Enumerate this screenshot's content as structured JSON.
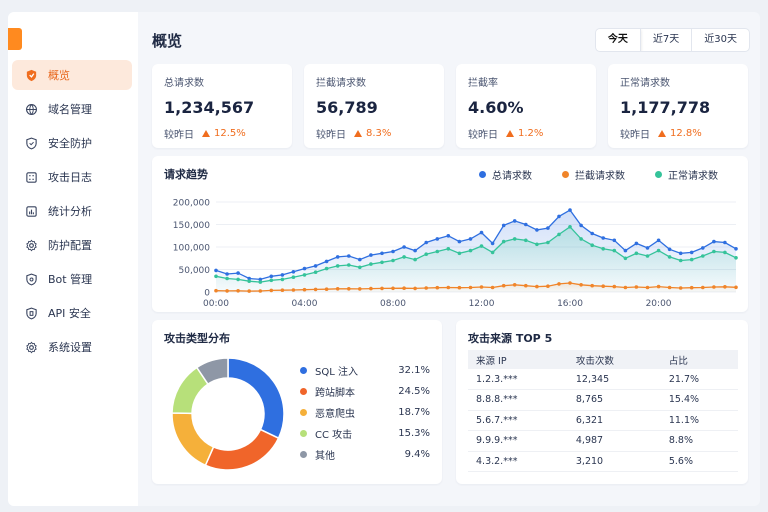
{
  "sidebar": {
    "items": [
      {
        "label": "概览",
        "icon": "shield-brand-icon",
        "active": true
      },
      {
        "label": "域名管理",
        "icon": "globe-icon"
      },
      {
        "label": "安全防护",
        "icon": "shield-icon"
      },
      {
        "label": "攻击日志",
        "icon": "log-icon"
      },
      {
        "label": "统计分析",
        "icon": "chart-icon"
      },
      {
        "label": "防护配置",
        "icon": "gear-icon"
      },
      {
        "label": "Bot 管理",
        "icon": "bot-shield-icon"
      },
      {
        "label": "API 安全",
        "icon": "api-shield-icon"
      },
      {
        "label": "系统设置",
        "icon": "settings-icon"
      }
    ]
  },
  "header": {
    "title": "概览",
    "ranges": [
      "今天",
      "近7天",
      "近30天"
    ],
    "active_range": "今天"
  },
  "stats": [
    {
      "label": "总请求数",
      "value": "1,234,567",
      "compare_label": "较昨日",
      "change": "12.5%"
    },
    {
      "label": "拦截请求数",
      "value": "56,789",
      "compare_label": "较昨日",
      "change": "8.3%"
    },
    {
      "label": "拦截率",
      "value": "4.60%",
      "compare_label": "较昨日",
      "change": "1.2%"
    },
    {
      "label": "正常请求数",
      "value": "1,177,778",
      "compare_label": "较昨日",
      "change": "12.8%"
    }
  ],
  "colors": {
    "accent": "#f06d1e",
    "total": "#2f6fe0",
    "blocked": "#f0852a",
    "normal": "#35c39a"
  },
  "trend": {
    "title": "请求趋势",
    "legend": [
      "总请求数",
      "拦截请求数",
      "正常请求数"
    ]
  },
  "pie": {
    "title": "攻击类型分布"
  },
  "top": {
    "title": "攻击来源 TOP 5",
    "columns": [
      "来源 IP",
      "攻击次数",
      "占比"
    ],
    "rows": [
      [
        "1.2.3.***",
        "12,345",
        "21.7%"
      ],
      [
        "8.8.8.***",
        "8,765",
        "15.4%"
      ],
      [
        "5.6.7.***",
        "6,321",
        "11.1%"
      ],
      [
        "9.9.9.***",
        "4,987",
        "8.8%"
      ],
      [
        "4.3.2.***",
        "3,210",
        "5.6%"
      ]
    ]
  },
  "chart_data": [
    {
      "type": "area",
      "title": "请求趋势",
      "x": [
        "00:00",
        "00:30",
        "01:00",
        "01:30",
        "02:00",
        "02:30",
        "03:00",
        "03:30",
        "04:00",
        "04:30",
        "05:00",
        "05:30",
        "06:00",
        "06:30",
        "07:00",
        "07:30",
        "08:00",
        "08:30",
        "09:00",
        "09:30",
        "10:00",
        "10:30",
        "11:00",
        "11:30",
        "12:00",
        "12:30",
        "13:00",
        "13:30",
        "14:00",
        "14:30",
        "15:00",
        "15:30",
        "16:00",
        "16:30",
        "17:00",
        "17:30",
        "18:00",
        "18:30",
        "19:00",
        "19:30",
        "20:00",
        "20:30",
        "21:00",
        "21:30",
        "22:00",
        "22:30",
        "23:00",
        "23:30"
      ],
      "x_tick_labels": [
        "00:00",
        "04:00",
        "08:00",
        "12:00",
        "16:00",
        "20:00"
      ],
      "y_tick_labels": [
        "0",
        "50,000",
        "100,000",
        "150,000",
        "200,000"
      ],
      "ylim": [
        0,
        200000
      ],
      "grid": true,
      "legend_position": "top-right",
      "series": [
        {
          "name": "总请求数",
          "values": [
            48000,
            40000,
            42000,
            30000,
            28000,
            35000,
            38000,
            45000,
            52000,
            58000,
            68000,
            78000,
            80000,
            72000,
            82000,
            86000,
            90000,
            100000,
            92000,
            110000,
            118000,
            125000,
            112000,
            118000,
            132000,
            108000,
            148000,
            158000,
            150000,
            138000,
            142000,
            168000,
            182000,
            148000,
            130000,
            120000,
            115000,
            92000,
            108000,
            98000,
            115000,
            95000,
            86000,
            88000,
            98000,
            112000,
            110000,
            96000
          ]
        },
        {
          "name": "拦截请求数",
          "values": [
            3000,
            2500,
            2600,
            2000,
            2200,
            3500,
            4000,
            4500,
            5200,
            5800,
            6200,
            7000,
            7200,
            6800,
            7500,
            8000,
            8200,
            8500,
            8000,
            9000,
            9500,
            10000,
            9500,
            10000,
            11000,
            10000,
            14000,
            16000,
            14000,
            12000,
            13000,
            18000,
            20000,
            16000,
            14000,
            13000,
            12000,
            10000,
            11000,
            10000,
            12000,
            10000,
            9000,
            9500,
            10000,
            11000,
            11500,
            10500
          ]
        },
        {
          "name": "正常请求数",
          "values": [
            35000,
            30000,
            28000,
            24000,
            22000,
            26000,
            28000,
            33000,
            38000,
            44000,
            52000,
            58000,
            60000,
            55000,
            62000,
            66000,
            70000,
            78000,
            72000,
            84000,
            90000,
            96000,
            86000,
            92000,
            102000,
            88000,
            112000,
            118000,
            115000,
            106000,
            110000,
            128000,
            145000,
            118000,
            104000,
            96000,
            92000,
            75000,
            86000,
            80000,
            92000,
            78000,
            70000,
            72000,
            80000,
            90000,
            88000,
            76000
          ]
        }
      ]
    },
    {
      "type": "pie",
      "title": "攻击类型分布",
      "categories": [
        "SQL 注入",
        "跨站脚本",
        "恶意爬虫",
        "CC 攻击",
        "其他"
      ],
      "values": [
        32.1,
        24.5,
        18.7,
        15.3,
        9.4
      ],
      "value_labels": [
        "32.1%",
        "24.5%",
        "18.7%",
        "15.3%",
        "9.4%"
      ],
      "colors": [
        "#2f6fe0",
        "#f0652a",
        "#f5b03a",
        "#b7e07a",
        "#8e97a6"
      ],
      "legend_position": "right"
    }
  ]
}
